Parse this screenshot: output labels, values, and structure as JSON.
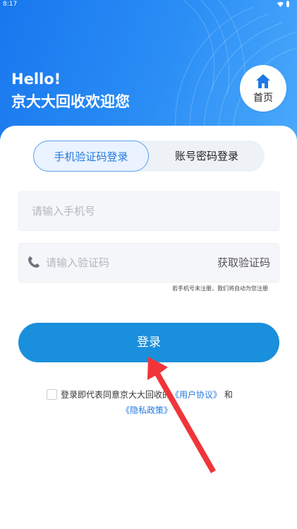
{
  "status_bar": {
    "time": "8:17"
  },
  "greeting": {
    "line1": "Hello!",
    "line2": "京大大回收欢迎您"
  },
  "home_button": {
    "label": "首页"
  },
  "tabs": [
    {
      "label": "手机验证码登录",
      "active": true
    },
    {
      "label": "账号密码登录",
      "active": false
    }
  ],
  "phone_input": {
    "placeholder": "请输入手机号",
    "value": ""
  },
  "code_input": {
    "placeholder": "请输入验证码",
    "value": ""
  },
  "get_code_label": "获取验证码",
  "hint_text": "若手机号未注册，我们将自动为您注册",
  "login_button": {
    "label": "登录"
  },
  "agreement": {
    "prefix": "登录即代表同意京大大回收的",
    "user_agreement": "《用户协议》",
    "conjunction": "和",
    "privacy_policy": "《隐私政策》",
    "checked": false
  },
  "colors": {
    "header_gradient_start": "#1877ee",
    "header_gradient_end": "#4aa9fb",
    "accent": "#2479de",
    "login_button": "#1a8fdb",
    "annotation_arrow": "#f0353a"
  }
}
